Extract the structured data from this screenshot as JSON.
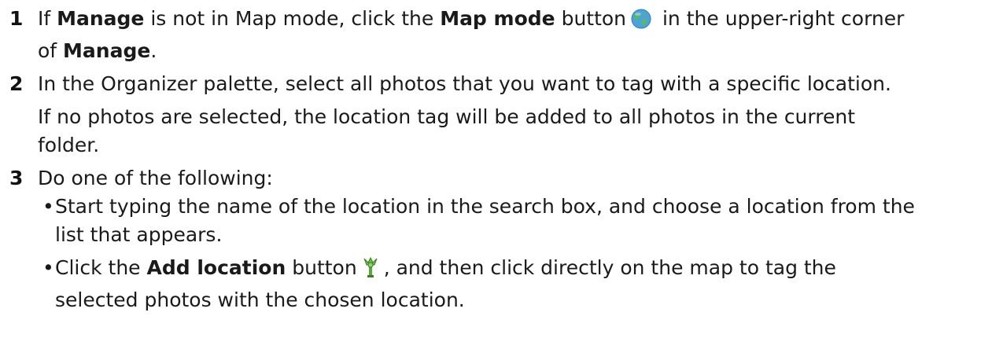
{
  "steps": [
    {
      "number": "1",
      "lines": [
        {
          "t1": "If ",
          "b1": "Manage",
          "t2": " is not in Map mode, click the ",
          "b2": "Map mode",
          "t3": " button",
          "icon": "globe-icon",
          "t4": " in the upper-right corner"
        },
        {
          "t1": "of ",
          "b1": "Manage",
          "t2": "."
        }
      ]
    },
    {
      "number": "2",
      "line1": "In the Organizer palette, select all photos that you want to tag with a specific location.",
      "line2": "If no photos are selected, the location tag will be added to all photos in the current",
      "line3": "folder."
    },
    {
      "number": "3",
      "line1": "Do one of the following:",
      "bullets": [
        {
          "marker": "•",
          "line1": "Start typing the name of the location in the search box, and choose a location from the",
          "line2": "list that appears."
        },
        {
          "marker": "•",
          "t1": "Click the ",
          "b1": "Add location",
          "t2": " button",
          "icon": "add-location-pin-icon",
          "t3": ", and then click directly on the map to tag the",
          "line2": "selected photos with the chosen location."
        }
      ]
    }
  ],
  "colors": {
    "text": "#1a1a1a",
    "globe_ocean": "#4aa3df",
    "globe_land": "#5cb85c",
    "pin_green": "#5aa83a"
  }
}
